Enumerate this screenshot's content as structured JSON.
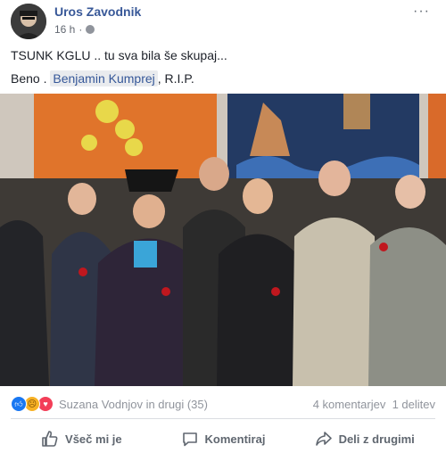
{
  "post": {
    "author": "Uros Zavodnik",
    "time": "16 h",
    "separator": "·",
    "more_label": "···",
    "line1": "TSUNK KGLU .. tu sva bila še skupaj...",
    "line2_prefix": "Beno . ",
    "line2_tag": "Benjamin Kumprej",
    "line2_suffix": ", R.I.P."
  },
  "reactions": {
    "icons": [
      "like-icon",
      "sad-icon",
      "love-icon"
    ],
    "text": "Suzana Vodnjov in drugi (35)",
    "comments": "4 komentarjev",
    "shares": "1 delitev"
  },
  "actions": {
    "like": "Všeč mi je",
    "comment": "Komentiraj",
    "share": "Deli z drugimi"
  },
  "colors": {
    "link": "#385898",
    "like": "#1877f2",
    "love": "#f33e58",
    "sad": "#f7b125"
  }
}
